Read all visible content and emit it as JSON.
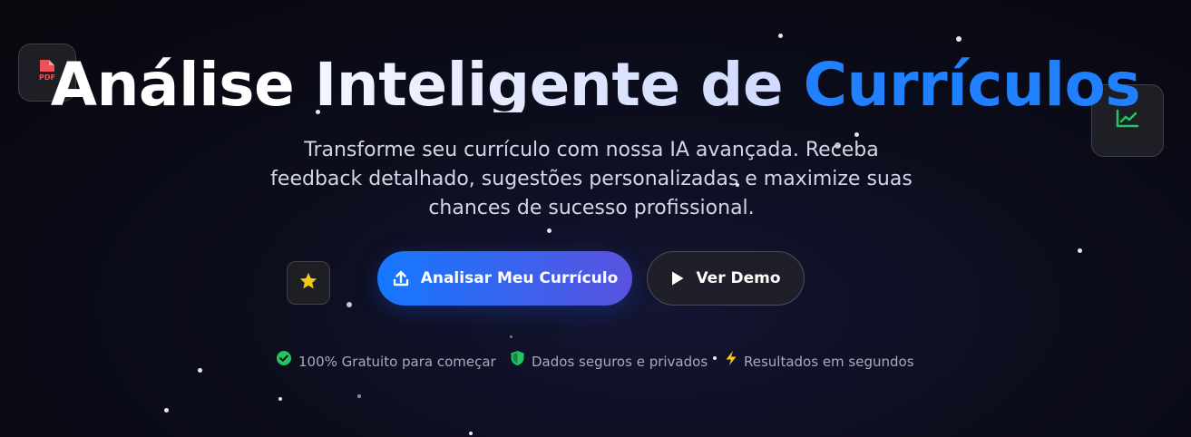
{
  "hero": {
    "title_part_1": "Análise ",
    "title_part_2": "Inteligente de ",
    "title_part_3": "Currículos",
    "subtitle": "Transforme seu currículo com nossa IA avançada. Receba feedback detalhado, sugestões personalizadas e maximize suas chances de sucesso profissional."
  },
  "buttons": {
    "primary_label": "Analisar Meu Currículo",
    "secondary_label": "Ver Demo"
  },
  "features": [
    {
      "icon": "check-circle-icon",
      "label": "100% Gratuito para começar"
    },
    {
      "icon": "shield-icon",
      "label": "Dados seguros e privados"
    },
    {
      "icon": "lightning-icon",
      "label": "Resultados em segundos"
    }
  ],
  "floating_icons": {
    "pdf": {
      "icon": "pdf-file-icon",
      "label": "PDF"
    },
    "chart": {
      "icon": "line-chart-icon"
    },
    "star": {
      "icon": "star-icon"
    }
  },
  "colors": {
    "accent_blue": "#2080ff",
    "button_gradient_start": "#1478ff",
    "button_gradient_end": "#5a52e0",
    "check_green": "#22c55e",
    "shield_green": "#22c55e",
    "lightning_yellow": "#facc15",
    "pdf_red": "#f0505a",
    "chart_green": "#22c55e",
    "star_yellow": "#f5c518"
  }
}
